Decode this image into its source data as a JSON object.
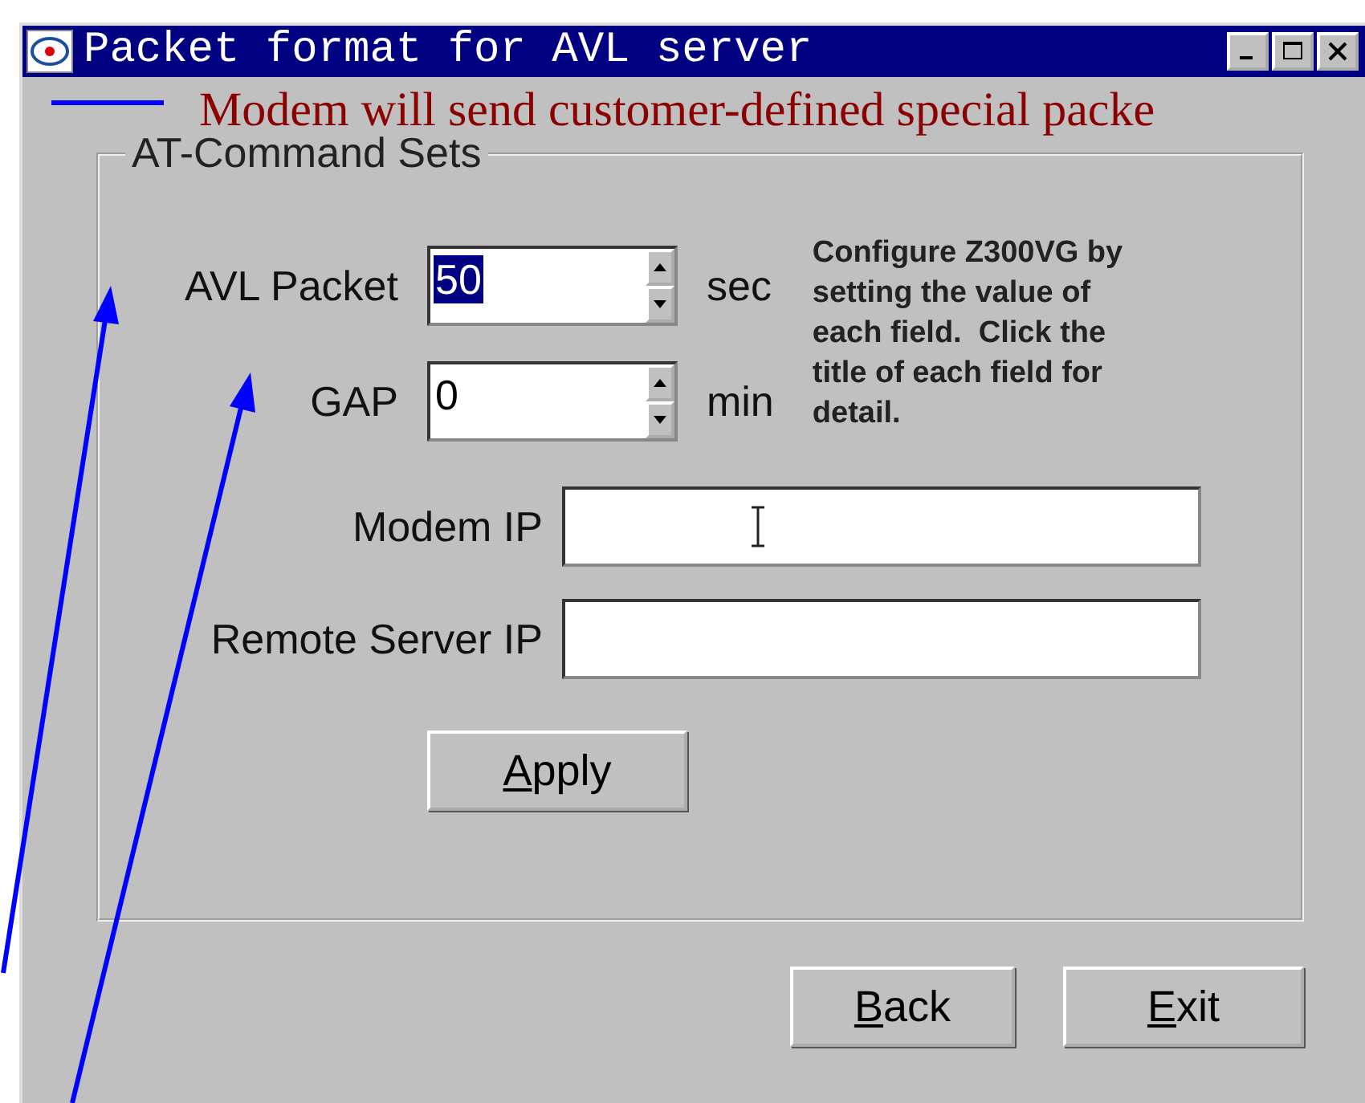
{
  "window": {
    "title": "Packet format for AVL server"
  },
  "annotation": {
    "text": "Modem will send customer-defined special packe"
  },
  "group": {
    "title": "AT-Command Sets"
  },
  "spin_fields": [
    {
      "label": "AVL Packet",
      "value": "50",
      "unit": "sec",
      "selected": true
    },
    {
      "label": "GAP",
      "value": "0",
      "unit": "min",
      "selected": false
    }
  ],
  "description": "Configure Z300VG by setting the value of each field.  Click the title of each field for detail.",
  "ip_fields": [
    {
      "label": "Modem IP",
      "cursor": true
    },
    {
      "label": "Remote Server IP",
      "cursor": false
    }
  ],
  "buttons": {
    "apply": "Apply",
    "back": "Back",
    "exit": "Exit"
  }
}
